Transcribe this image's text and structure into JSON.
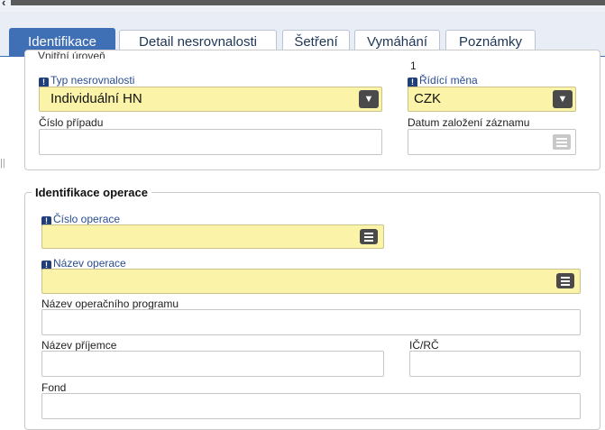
{
  "tabs": [
    {
      "label": "Identifikace",
      "active": true
    },
    {
      "label": "Detail nesrovnalosti",
      "active": false
    },
    {
      "label": "Šetření",
      "active": false
    },
    {
      "label": "Vymáhání",
      "active": false
    },
    {
      "label": "Poznámky",
      "active": false
    }
  ],
  "section1": {
    "cut_label": "Vnitřní úroveň",
    "level_value": "1",
    "typ_label": "Typ nesrovnalosti",
    "typ_value": "Individuální HN",
    "mena_label": "Řídící měna",
    "mena_value": "CZK",
    "cislo_pripadu_label": "Číslo případu",
    "cislo_pripadu_value": "",
    "datum_label": "Datum založení záznamu",
    "datum_value": ""
  },
  "section2": {
    "title": "Identifikace operace",
    "cislo_operace_label": "Číslo operace",
    "cislo_operace_value": "",
    "nazev_operace_label": "Název operace",
    "nazev_operace_value": "",
    "nazev_programu_label": "Název operačního programu",
    "nazev_programu_value": "",
    "nazev_prijemce_label": "Název příjemce",
    "nazev_prijemce_value": "",
    "ic_label": "IČ/RČ",
    "ic_value": "",
    "fond_label": "Fond",
    "fond_value": ""
  },
  "colors": {
    "accent": "#3f6fb4",
    "required_field": "#fbf4a8"
  },
  "icons": {
    "required": "exclamation-icon",
    "dropdown": "chevron-down-icon",
    "list": "list-icon",
    "calendar": "calendar-icon"
  }
}
